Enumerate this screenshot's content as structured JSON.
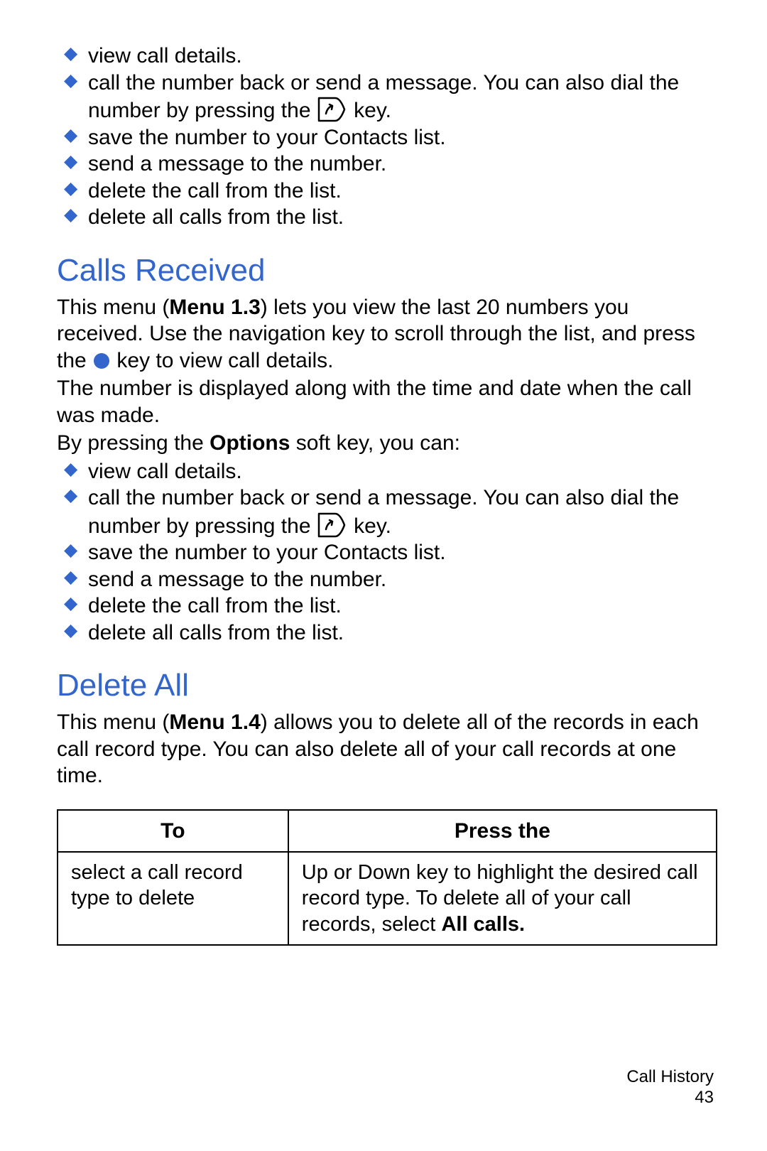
{
  "bullets_top": [
    "view call details.",
    [
      "call the number back or send a message. You can also dial the number by pressing the ",
      {
        "icon": "send-key"
      },
      " key."
    ],
    "save the number to your Contacts list.",
    "send a message to the number.",
    "delete the call from the list.",
    "delete all calls from the list."
  ],
  "calls_received": {
    "heading": "Calls Received",
    "para1_pre": "This menu (",
    "para1_bold": "Menu 1.3",
    "para1_mid": ") lets you view the last 20 numbers you received. Use the navigation key to scroll through the list, and press the ",
    "para1_post": " key to view call details.",
    "para2": "The number is displayed along with the time and date when the call was made.",
    "para3_pre": "By pressing the ",
    "para3_bold": "Options",
    "para3_post": " soft key, you can:",
    "bullets": [
      "view call details.",
      [
        "call the number back or send a message. You can also dial the number by pressing the ",
        {
          "icon": "send-key"
        },
        " key."
      ],
      "save the number to your Contacts list.",
      "send a message to the number.",
      "delete the call from the list.",
      "delete all calls from the list."
    ]
  },
  "delete_all": {
    "heading": "Delete All",
    "para_pre": "This menu (",
    "para_bold": "Menu 1.4",
    "para_post": ") allows you to delete all of the records in each call record type. You can also delete all of your call records at one time.",
    "table": {
      "headers": [
        "To",
        "Press the"
      ],
      "row": {
        "left": "select a call record type to delete",
        "right_pre": "Up or Down key to highlight the desired call record type. To delete all of your call records, select ",
        "right_bold": "All calls.",
        "right_post": ""
      }
    }
  },
  "footer": {
    "section": "Call History",
    "page": "43"
  }
}
